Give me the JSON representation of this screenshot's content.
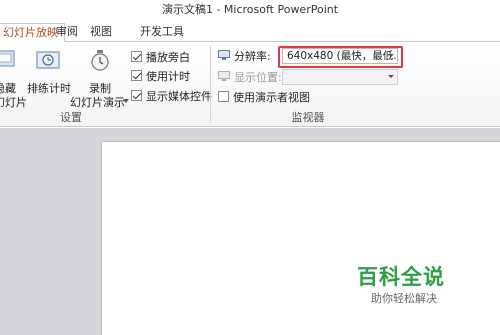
{
  "window": {
    "title": "演示文稿1 - Microsoft PowerPoint"
  },
  "tabs": [
    {
      "label": "幻灯片放映",
      "active": true
    },
    {
      "label": "审阅"
    },
    {
      "label": "视图"
    },
    {
      "label": "开发工具"
    }
  ],
  "ribbon": {
    "left_cut": {
      "line1": "隐藏",
      "line2": "幻灯片"
    },
    "rehearse": {
      "label": "排练计时"
    },
    "record": {
      "line1": "录制",
      "line2": "幻灯片演示"
    },
    "setup_checks": [
      {
        "label": "播放旁白",
        "checked": true
      },
      {
        "label": "使用计时",
        "checked": true
      },
      {
        "label": "显示媒体控件",
        "checked": true
      }
    ],
    "setup_group_label": "设置",
    "monitors": {
      "resolution_label": "分辨率:",
      "resolution_value": "640x480 (最快，最低...",
      "show_on_label": "显示位置:",
      "show_on_value": "",
      "presenter_view_label": "使用演示者视图",
      "presenter_view_checked": false,
      "group_label": "监视器"
    }
  },
  "watermark": {
    "title": "百科全说",
    "subtitle": "助你轻松解决"
  },
  "colors": {
    "accent_tab": "#b24a1c",
    "highlight": "#e0393e",
    "watermark": "#2e9e45"
  }
}
